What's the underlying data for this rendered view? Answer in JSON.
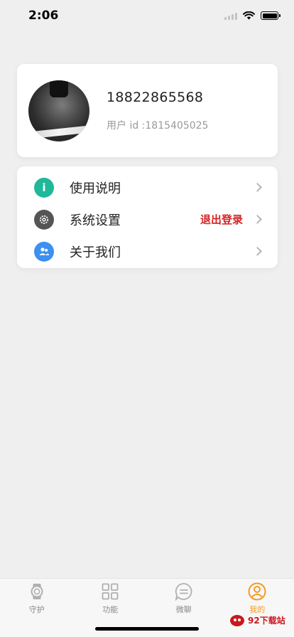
{
  "status": {
    "time": "2:06"
  },
  "profile": {
    "phone": "18822865568",
    "user_id": "用户 id :1815405025"
  },
  "menu": {
    "items": [
      {
        "label": "使用说明",
        "icon": "info-icon",
        "color": "#1fb89a"
      },
      {
        "label": "系统设置",
        "icon": "gear-icon",
        "color": "#555555",
        "extra": "退出登录"
      },
      {
        "label": "关于我们",
        "icon": "people-icon",
        "color": "#3d8ff0"
      }
    ]
  },
  "tabs": [
    {
      "label": "守护",
      "icon": "watch-icon",
      "active": false
    },
    {
      "label": "功能",
      "icon": "grid-icon",
      "active": false
    },
    {
      "label": "微聊",
      "icon": "chat-icon",
      "active": false
    },
    {
      "label": "我的",
      "icon": "user-icon",
      "active": true
    }
  ],
  "watermark": {
    "text": "92下载站"
  },
  "colors": {
    "accent": "#f59a23",
    "logout": "#d42222",
    "background": "#efefef"
  }
}
